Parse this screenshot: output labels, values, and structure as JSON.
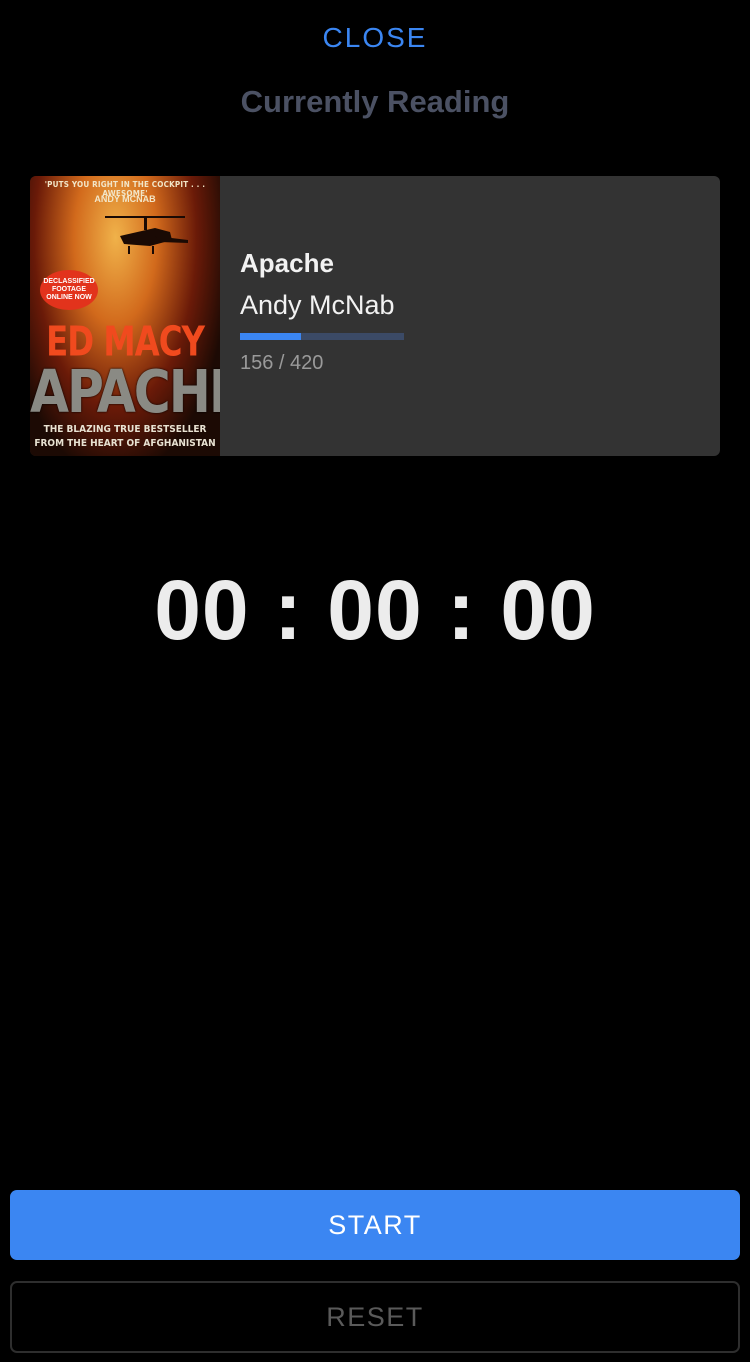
{
  "colors": {
    "accent": "#3b86f2",
    "background": "#000000",
    "card": "#333333",
    "title_gray": "#4b5163",
    "reset_text": "#5a5a5a",
    "progress_fill": "#3b86f2"
  },
  "header": {
    "close_label": "CLOSE",
    "title": "Currently Reading"
  },
  "book": {
    "title": "Apache",
    "author": "Andy McNab",
    "pages_text": "156 / 420",
    "pages_read": 156,
    "pages_total": 420,
    "cover": {
      "quote": "'PUTS YOU RIGHT IN THE COCKPIT . . . AWESOME'",
      "quote_author": "ANDY MCNAB",
      "badge": "DECLASSIFIED FOOTAGE ONLINE NOW",
      "author": "ED MACY",
      "title": "APACHE",
      "tagline_1": "THE BLAZING TRUE BESTSELLER",
      "tagline_2": "FROM THE HEART OF AFGHANISTAN"
    }
  },
  "timer": {
    "display": "00 : 00 : 00"
  },
  "controls": {
    "start_label": "START",
    "reset_label": "RESET"
  }
}
